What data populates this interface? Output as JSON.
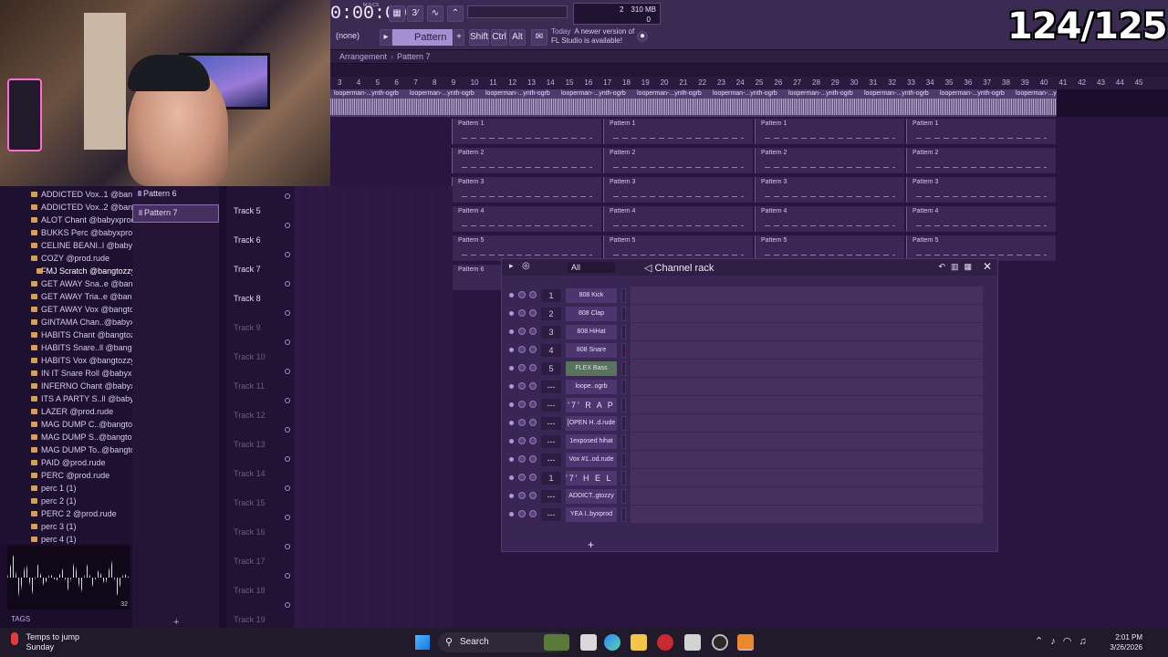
{
  "stream": {
    "counter": "124/125"
  },
  "fl_toolbar": {
    "time": "0:00:00",
    "time_unit": "M:S:CS",
    "pattern": "Pattern 7",
    "none_label": "(none)",
    "shift_label": "Shift",
    "ctrl_label": "Ctrl",
    "alt_label": "Alt",
    "news_today": "Today",
    "news_text_1": "A newer version of",
    "news_text_2": "FL Studio is available!",
    "memory": "310 MB",
    "cores": "2",
    "polyphony": "0"
  },
  "arrangement": {
    "title": "Arrangement",
    "pattern": "Pattern 7",
    "ruler_ticks": [
      "3",
      "4",
      "5",
      "6",
      "7",
      "8",
      "9",
      "10",
      "11",
      "12",
      "13",
      "14",
      "15",
      "16",
      "17",
      "18",
      "19",
      "20",
      "21",
      "22",
      "23",
      "24",
      "25",
      "26",
      "27",
      "28",
      "29",
      "30",
      "31",
      "32",
      "33",
      "34",
      "35",
      "36",
      "37",
      "38",
      "39",
      "40",
      "41",
      "42",
      "43",
      "44",
      "45"
    ],
    "audio_clip_label": "looperman-...ynth-ogrb",
    "pattern_clips": [
      {
        "label": "Pattern 1"
      },
      {
        "label": "Pattern 2"
      },
      {
        "label": "Pattern 3"
      },
      {
        "label": "Pattern 4"
      },
      {
        "label": "Pattern 5"
      },
      {
        "label": "Pattern 6"
      }
    ]
  },
  "browser": {
    "items": [
      {
        "label": "ADDICTED Vox..1 @bangtozzy"
      },
      {
        "label": "ADDICTED Vox..2 @bangtozzy"
      },
      {
        "label": "ALOT Chant @babyxprod"
      },
      {
        "label": "BUKKS Perc @babyxprod"
      },
      {
        "label": "CELINE BEANI..l @babyxprod"
      },
      {
        "label": "COZY @prod.rude"
      },
      {
        "label": "FMJ Scratch @bangtozzy"
      },
      {
        "label": "GET AWAY Sna..e @bangtozzy"
      },
      {
        "label": "GET AWAY Tria..e @bangtozzy"
      },
      {
        "label": "GET AWAY Vox @bangtozzy"
      },
      {
        "label": "GINTAMA Chan..@babyxprod"
      },
      {
        "label": "HABITS Chant @bangtozzy"
      },
      {
        "label": "HABITS Snare..ll @bangtozzy"
      },
      {
        "label": "HABITS Vox @bangtozzy"
      },
      {
        "label": "IN IT Snare Roll @babyxprod"
      },
      {
        "label": "INFERNO Chant @babyxprod"
      },
      {
        "label": "ITS A PARTY S..ll @babyxprod"
      },
      {
        "label": "LAZER @prod.rude"
      },
      {
        "label": "MAG DUMP C..@bangtozzy"
      },
      {
        "label": "MAG DUMP S..@bangtozzy"
      },
      {
        "label": "MAG DUMP To..@bangtozzy"
      },
      {
        "label": "PAID @prod.rude"
      },
      {
        "label": "PERC @prod.rude"
      },
      {
        "label": "perc 1 (1)"
      },
      {
        "label": "perc 2 (1)"
      },
      {
        "label": "PERC 2 @prod.rude"
      },
      {
        "label": "perc 3 (1)"
      },
      {
        "label": "perc 4 (1)"
      }
    ],
    "selected_index": 6,
    "waveform_info": "32",
    "tags_label": "TAGS"
  },
  "patterns_panel": {
    "items": [
      {
        "label": "Pattern 6"
      },
      {
        "label": "Pattern 7"
      }
    ],
    "add_label": "+"
  },
  "tracks": [
    {
      "label": "Track 5"
    },
    {
      "label": "Track 6"
    },
    {
      "label": "Track 7"
    },
    {
      "label": "Track 8"
    },
    {
      "label": "Track 9"
    },
    {
      "label": "Track 10"
    },
    {
      "label": "Track 11"
    },
    {
      "label": "Track 12"
    },
    {
      "label": "Track 13"
    },
    {
      "label": "Track 14"
    },
    {
      "label": "Track 15"
    },
    {
      "label": "Track 16"
    },
    {
      "label": "Track 17"
    },
    {
      "label": "Track 18"
    },
    {
      "label": "Track 19"
    }
  ],
  "channel_rack": {
    "title": "Channel rack",
    "filter": "All",
    "add_label": "+",
    "channels": [
      {
        "ch": "1",
        "name": "808 Kick"
      },
      {
        "ch": "2",
        "name": "808 Clap"
      },
      {
        "ch": "3",
        "name": "808 HiHat"
      },
      {
        "ch": "4",
        "name": "808 Snare"
      },
      {
        "ch": "5",
        "name": "FLEX Bass"
      },
      {
        "ch": "---",
        "name": "loope..ogrb"
      },
      {
        "ch": "---",
        "name": "'7' R A P"
      },
      {
        "ch": "---",
        "name": "[OPEN H..d.rude"
      },
      {
        "ch": "---",
        "name": "1exposed hihat"
      },
      {
        "ch": "---",
        "name": "Vox #1..od.rude"
      },
      {
        "ch": "1",
        "name": "'7' H E L L"
      },
      {
        "ch": "---",
        "name": "ADDICT..gtozzy"
      },
      {
        "ch": "---",
        "name": "YEA I..byxprod"
      }
    ]
  },
  "taskbar": {
    "weather_title": "Temps to jump",
    "weather_sub": "Sunday",
    "search_label": "Search",
    "time": "2:01 PM",
    "date": "3/26/2026"
  },
  "colors": {
    "accent": "#a78fd4",
    "flex_bass": "#58745a",
    "background": "#2a1540"
  }
}
